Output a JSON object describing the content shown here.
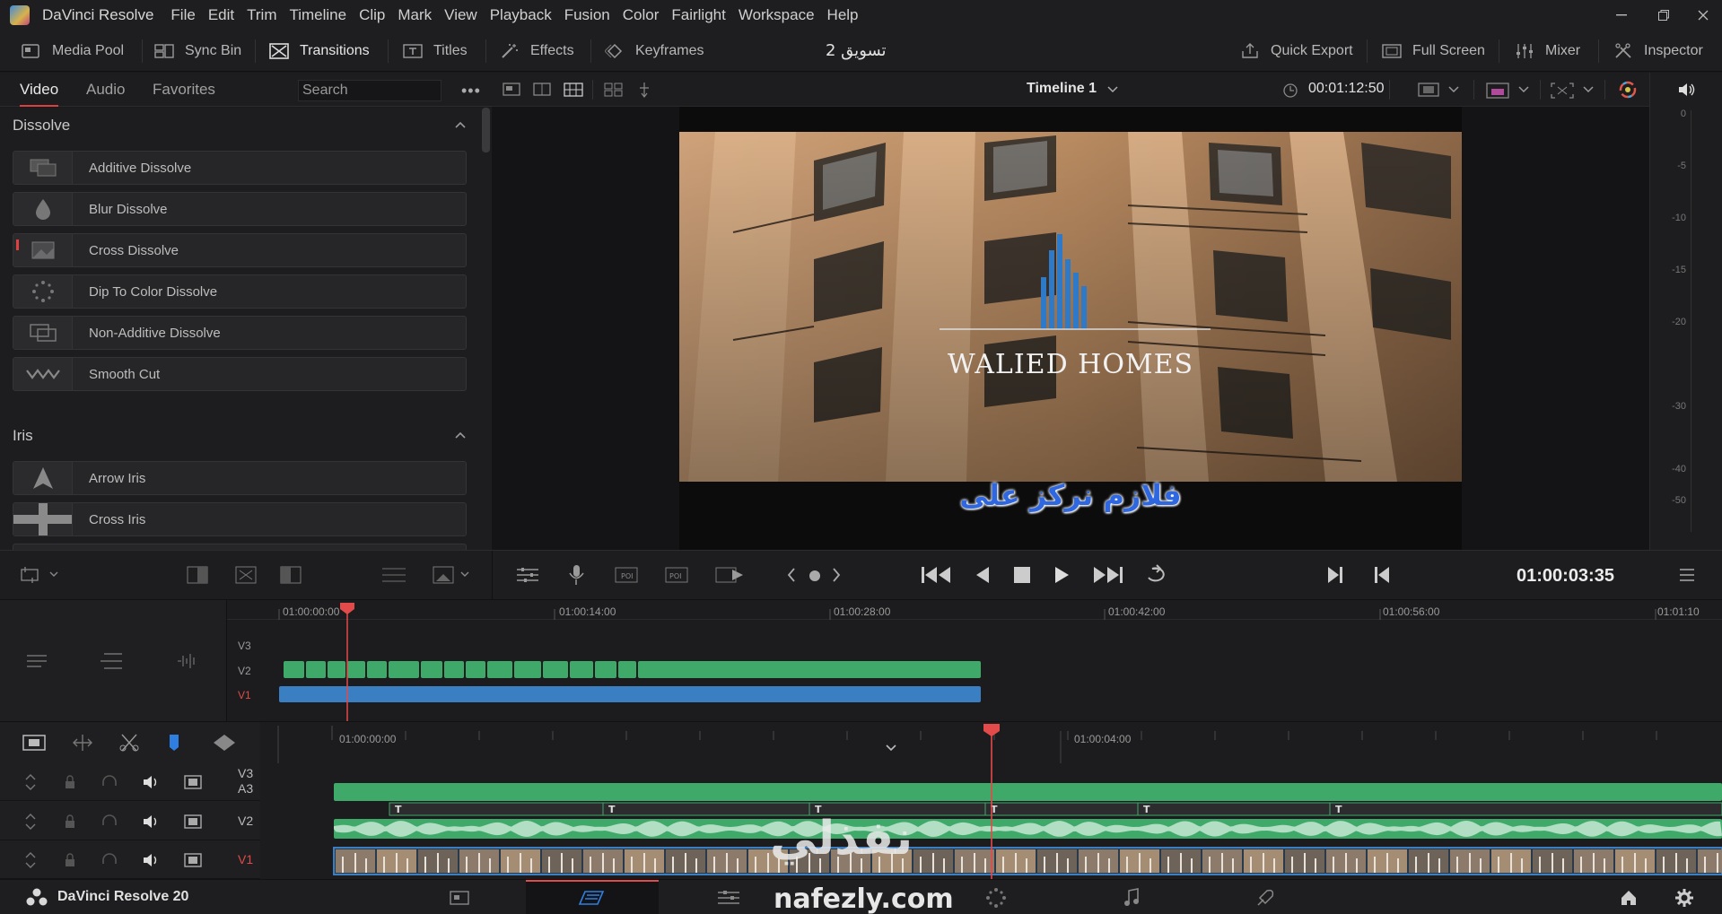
{
  "app": {
    "name": "DaVinci Resolve"
  },
  "menu": [
    "File",
    "Edit",
    "Trim",
    "Timeline",
    "Clip",
    "Mark",
    "View",
    "Playback",
    "Fusion",
    "Color",
    "Fairlight",
    "Workspace",
    "Help"
  ],
  "toolbar": {
    "media_pool": "Media Pool",
    "sync_bin": "Sync Bin",
    "transitions": "Transitions",
    "titles": "Titles",
    "effects": "Effects",
    "keyframes": "Keyframes",
    "project_title": "تسويق 2",
    "quick_export": "Quick Export",
    "full_screen": "Full Screen",
    "mixer": "Mixer",
    "inspector": "Inspector"
  },
  "effects_panel": {
    "tabs": [
      "Video",
      "Audio",
      "Favorites"
    ],
    "active_tab": "Video",
    "search_placeholder": "Search",
    "sections": [
      {
        "title": "Dissolve",
        "items": [
          "Additive Dissolve",
          "Blur Dissolve",
          "Cross Dissolve",
          "Dip To Color Dissolve",
          "Non-Additive Dissolve",
          "Smooth Cut"
        ]
      },
      {
        "title": "Iris",
        "items": [
          "Arrow Iris",
          "Cross Iris"
        ]
      }
    ]
  },
  "viewer": {
    "timeline_name": "Timeline 1",
    "duration": "00:01:12:50",
    "logo_text": "WALIED HOMES",
    "subtitle": "فلازم نركز على"
  },
  "audio_meter": {
    "ticks": [
      "0",
      "-5",
      "-10",
      "-15",
      "-20",
      "-30",
      "-40",
      "-50"
    ]
  },
  "transport": {
    "timecode": "01:00:03:35"
  },
  "overview_timeline": {
    "ruler": [
      "01:00:00:00",
      "01:00:14:00",
      "01:00:28:00",
      "01:00:42:00",
      "01:00:56:00",
      "01:01:10"
    ],
    "tracks": [
      "V3",
      "V2",
      "V1"
    ]
  },
  "timeline": {
    "ruler": [
      "01:00:00:00",
      "01:00:04:00"
    ],
    "tracks": [
      {
        "name": "V3",
        "sub": "A3"
      },
      {
        "name": "V2",
        "sub": ""
      },
      {
        "name": "V1",
        "sub": ""
      }
    ]
  },
  "watermark": {
    "arabic": "نفذلي",
    "domain": "nafezly.com"
  },
  "footer": {
    "version": "DaVinci Resolve 20"
  },
  "colors": {
    "accent_red": "#e34a4a",
    "clip_green": "#3fa96a",
    "clip_blue": "#3a7fc1"
  }
}
